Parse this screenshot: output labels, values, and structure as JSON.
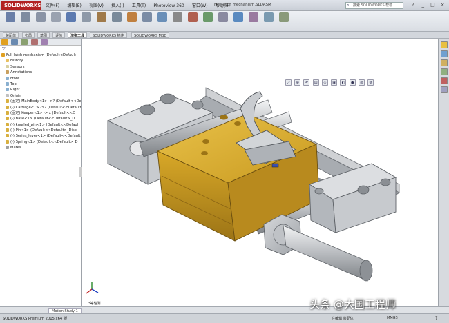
{
  "app": {
    "logo_text": "SOLIDWORKS",
    "window_title": "Full latch mechanism.SLDASM",
    "menus": [
      "文件(F)",
      "编辑(E)",
      "视图(V)",
      "插入(I)",
      "工具(T)",
      "Photoview 360",
      "窗口(W)",
      "帮助(H)"
    ],
    "search_placeholder": "搜索 SOLIDWORKS 帮助",
    "window_buttons": [
      "?",
      "_",
      "□",
      "×"
    ]
  },
  "ribbon": {
    "tools": [
      {
        "icon": "insert-components-icon",
        "color": "#6a7fa8"
      },
      {
        "icon": "mate-icon",
        "color": "#7f8ca0"
      },
      {
        "icon": "linear-pattern-icon",
        "color": "#8a94a6"
      },
      {
        "icon": "smart-fasteners-icon",
        "color": "#9aa2b0"
      },
      {
        "icon": "move-component-icon",
        "color": "#5c7ab0"
      },
      {
        "icon": "show-hidden-icon",
        "color": "#8e99a8"
      },
      {
        "icon": "assembly-features-icon",
        "color": "#a07a4a"
      },
      {
        "icon": "reference-geometry-icon",
        "color": "#7a8a9a"
      },
      {
        "icon": "new-motion-study-icon",
        "color": "#c08040"
      },
      {
        "icon": "bill-of-materials-icon",
        "color": "#7b8ca5"
      },
      {
        "icon": "exploded-view-icon",
        "color": "#6a8fb8"
      },
      {
        "icon": "explode-line-sketch-icon",
        "color": "#8a8a8a"
      },
      {
        "icon": "interference-detection-icon",
        "color": "#b06050"
      },
      {
        "icon": "clearance-verification-icon",
        "color": "#6a9a6a"
      },
      {
        "icon": "hole-alignment-icon",
        "color": "#8a8aa0"
      },
      {
        "icon": "instant3d-icon",
        "color": "#5a8ac0"
      },
      {
        "icon": "update-speedpak-icon",
        "color": "#9a7aa0"
      },
      {
        "icon": "take-snapshot-icon",
        "color": "#7a9ab0"
      },
      {
        "icon": "large-assembly-mode-icon",
        "color": "#8a9a7a"
      }
    ]
  },
  "cm_tabs": [
    "装配体",
    "布局",
    "草图",
    "评估",
    "渲染工具",
    "SOLIDWORKS 插件",
    "SOLIDWORKS MBD"
  ],
  "cm_active": 4,
  "tree": {
    "items": [
      {
        "text": "Full latch mechanism (Default<Default",
        "icon": "assembly-icon",
        "color": "#e0a020",
        "indent": 0
      },
      {
        "text": "History",
        "icon": "history-icon",
        "color": "#e8c060",
        "indent": 1
      },
      {
        "text": "Sensors",
        "icon": "sensor-icon",
        "color": "#d8d0a0",
        "indent": 1
      },
      {
        "text": "Annotations",
        "icon": "annotation-icon",
        "color": "#c8a060",
        "indent": 1
      },
      {
        "text": "Front",
        "icon": "plane-icon",
        "color": "#8ab0d0",
        "indent": 1
      },
      {
        "text": "Top",
        "icon": "plane-icon",
        "color": "#8ab0d0",
        "indent": 1
      },
      {
        "text": "Right",
        "icon": "plane-icon",
        "color": "#8ab0d0",
        "indent": 1
      },
      {
        "text": "Origin",
        "icon": "origin-icon",
        "color": "#c0c0c0",
        "indent": 1
      },
      {
        "text": "(固定) MainBody<1> ->? (Default<<Default",
        "icon": "part-icon",
        "color": "#d8b040",
        "indent": 1
      },
      {
        "text": "(-) Carriage<1> ->? (Default<<Default",
        "icon": "part-icon",
        "color": "#d8b040",
        "indent": 1
      },
      {
        "text": "(固定) Keeper<1> -> x (Default<<D",
        "icon": "part-icon",
        "color": "#d8b040",
        "indent": 1
      },
      {
        "text": "(-) Base<1> (Default<<Default>_D",
        "icon": "part-icon",
        "color": "#d8b040",
        "indent": 1
      },
      {
        "text": "(-) knurled_pin<1> (Default<<Defaul",
        "icon": "part-icon",
        "color": "#d8b040",
        "indent": 1
      },
      {
        "text": "(-) Pin<1> (Default<<Default>_Disp",
        "icon": "part-icon",
        "color": "#d8b040",
        "indent": 1
      },
      {
        "text": "(-) Series_lever<1> (Default<<Default",
        "icon": "part-icon",
        "color": "#d8b040",
        "indent": 1
      },
      {
        "text": "(-) Spring<1> (Default<<Default>_D",
        "icon": "part-icon",
        "color": "#d8b040",
        "indent": 1
      },
      {
        "text": "Mates",
        "icon": "mates-icon",
        "color": "#a0a0a0",
        "indent": 1
      }
    ]
  },
  "viewport": {
    "view_label": "*等轴测"
  },
  "bottom_tab": "Motion Study 1",
  "status": {
    "left": "SOLIDWORKS Premium 2015 x64 版",
    "mid": "在编辑 装配体",
    "unit": "MMGS",
    "help": "?"
  },
  "watermark": "头条 @大国工程师",
  "colors": {
    "brass": "#d6a528",
    "steel": "#b9bcc0",
    "brand": "#b22222"
  }
}
